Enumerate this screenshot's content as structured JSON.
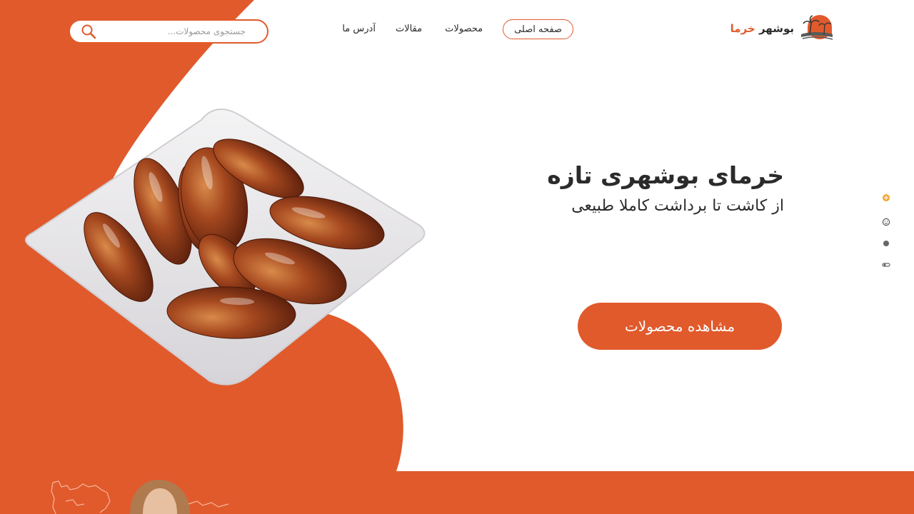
{
  "brand": {
    "name_part1": "بوشهر",
    "name_part2": "خرما",
    "accent_color": "#e15a2c",
    "logo_icon": "palm-tree-sunset-logo-icon"
  },
  "nav": {
    "items": [
      {
        "label": "صفحه اصلی",
        "active": true
      },
      {
        "label": "محصولات",
        "active": false
      },
      {
        "label": "مقالات",
        "active": false
      },
      {
        "label": "آدرس ما",
        "active": false
      }
    ]
  },
  "search": {
    "placeholder": "جستجوی محصولات...",
    "value": "",
    "icon": "search-icon"
  },
  "hero": {
    "title": "خرمای بوشهری تازه",
    "subtitle": "از کاشت تا برداشت کاملا طبیعی",
    "cta_label": "مشاهده محصولات",
    "image": "dates-on-plate-image"
  },
  "side_dots": {
    "icons": [
      "sun-icon",
      "smile-icon",
      "circle-icon",
      "toggle-icon"
    ]
  },
  "footer_band": {
    "images": [
      "iran-map-outline-icon",
      "person-photo"
    ]
  }
}
